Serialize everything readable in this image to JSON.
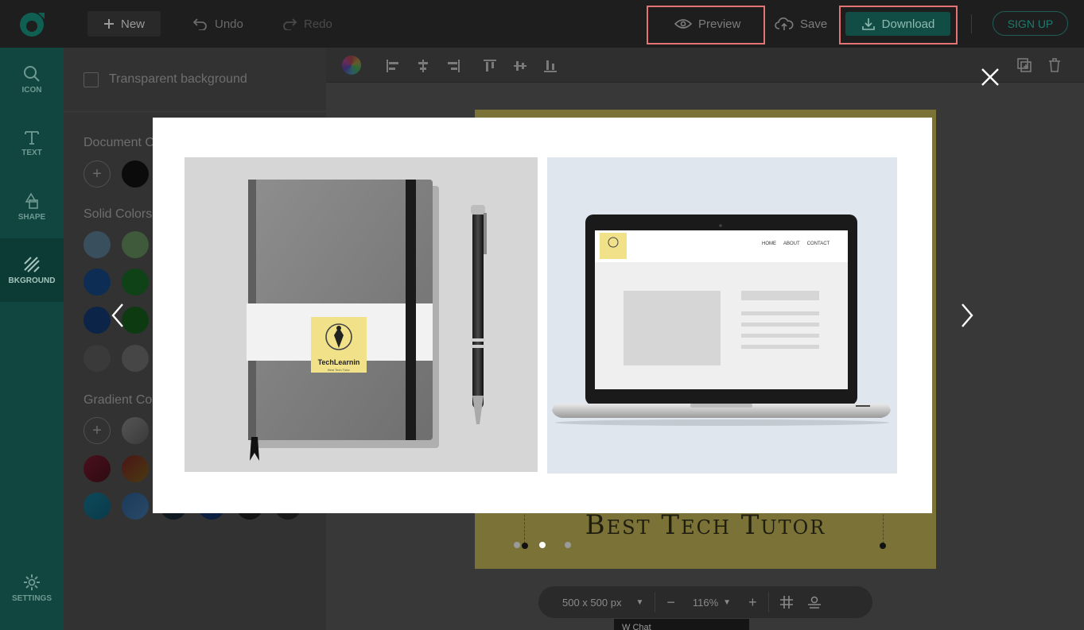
{
  "topbar": {
    "new_label": "New",
    "undo_label": "Undo",
    "redo_label": "Redo",
    "preview_label": "Preview",
    "save_label": "Save",
    "download_label": "Download",
    "signup_label": "SIGN UP"
  },
  "sidebar": {
    "items": [
      {
        "label": "ICON",
        "icon": "search-icon"
      },
      {
        "label": "TEXT",
        "icon": "text-icon"
      },
      {
        "label": "SHAPE",
        "icon": "shape-icon"
      },
      {
        "label": "BKGROUND",
        "icon": "background-icon"
      },
      {
        "label": "SETTINGS",
        "icon": "gear-icon"
      }
    ]
  },
  "panel": {
    "transparent_label": "Transparent background",
    "document_colors_label": "Document C",
    "solid_colors_label": "Solid Colors",
    "gradient_colors_label": "Gradient Col"
  },
  "design": {
    "tagline": "Best Tech Tutor"
  },
  "bottombar": {
    "size_label": "500 x 500 px",
    "zoom_label": "116%"
  },
  "tooltip": {
    "text": "W  Chat"
  },
  "preview": {
    "notebook_logo_title": "TechLearnin",
    "notebook_logo_sub": "Best Tech Tutor",
    "website_nav": [
      "HOME",
      "ABOUT",
      "CONTACT"
    ],
    "slides_total": 3,
    "active_slide": 2
  },
  "colors": {
    "accent": "#1a9b86",
    "highlight": "#e57373",
    "design_bg": "#f3e58a"
  }
}
